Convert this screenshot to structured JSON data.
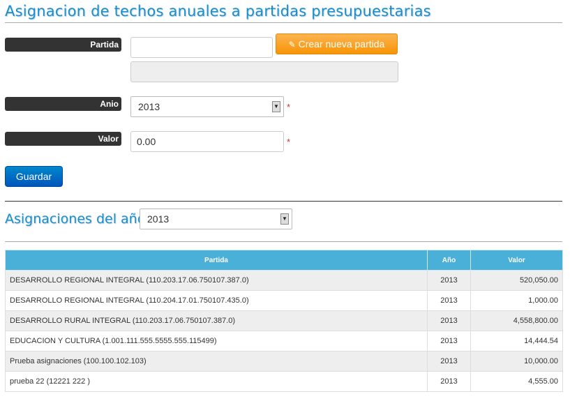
{
  "page": {
    "title": "Asignacion de techos anuales a partidas presupuestarias"
  },
  "form": {
    "partida_label": "Partida",
    "partida_value": "",
    "partida_description": "",
    "create_button": "Crear nueva partida",
    "anio_label": "Anio",
    "anio_value": "2013",
    "valor_label": "Valor",
    "valor_value": "0.00",
    "required_mark": "*",
    "save_button": "Guardar"
  },
  "asignaciones": {
    "title": "Asignaciones del año",
    "year_value": "2013",
    "columns": [
      "Partida",
      "Año",
      "Valor"
    ],
    "rows": [
      {
        "partida": "DESARROLLO REGIONAL INTEGRAL (110.203.17.06.750107.387.0)",
        "anio": "2013",
        "valor": "520,050.00"
      },
      {
        "partida": "DESARROLLO REGIONAL INTEGRAL (110.204.17.01.750107.435.0)",
        "anio": "2013",
        "valor": "1,000.00"
      },
      {
        "partida": "DESARROLLO RURAL INTEGRAL (110.203.17.06.750107.387.0)",
        "anio": "2013",
        "valor": "4,558,800.00"
      },
      {
        "partida": "EDUCACION Y CULTURA (1.001.111.555.5555.555.115499)",
        "anio": "2013",
        "valor": "14,444.54"
      },
      {
        "partida": "Prueba asignaciones (100.100.102.103)",
        "anio": "2013",
        "valor": "10,000.00"
      },
      {
        "partida": "prueba 22 (12221 222 )",
        "anio": "2013",
        "valor": "4,555.00"
      }
    ]
  },
  "icons": {
    "edit": "edit-icon",
    "dropdown": "dropdown-arrow-icon"
  },
  "colors": {
    "title": "#1a8fce",
    "create_button": "#f89406",
    "save_button": "#0077c8",
    "table_header": "#4ab0d8"
  }
}
